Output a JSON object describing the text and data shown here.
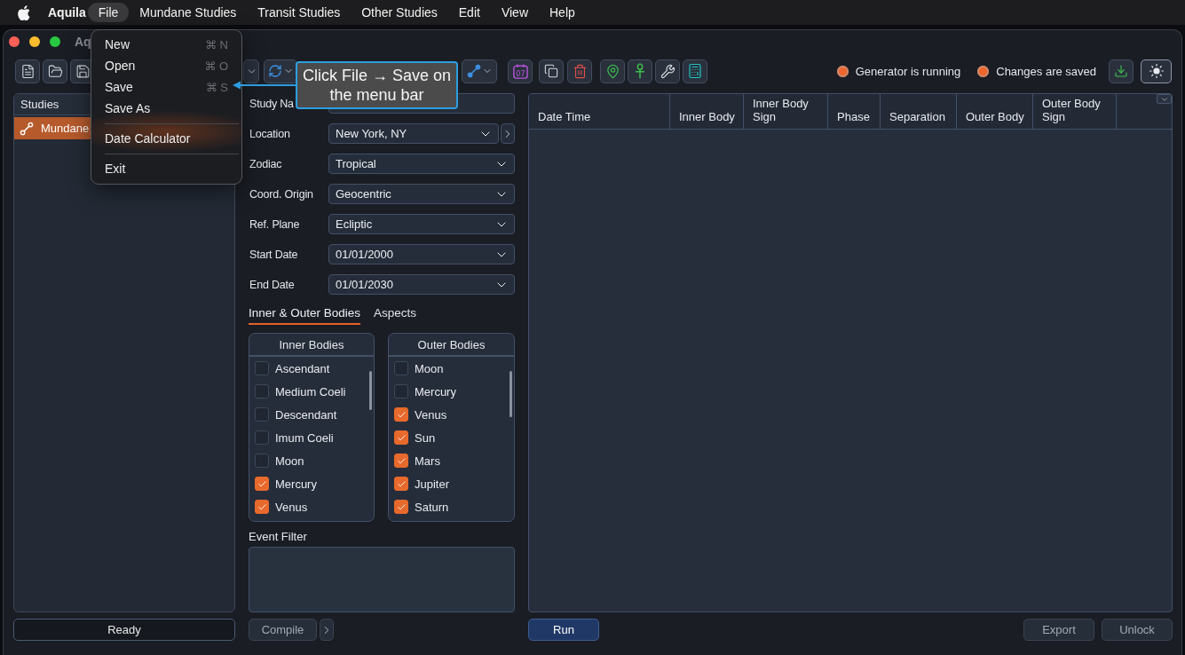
{
  "menu_bar": {
    "app_name": "Aquila",
    "items": [
      {
        "label": "File",
        "selected": true
      },
      {
        "label": "Mundane Studies",
        "selected": false
      },
      {
        "label": "Transit Studies",
        "selected": false
      },
      {
        "label": "Other Studies",
        "selected": false
      },
      {
        "label": "Edit",
        "selected": false
      },
      {
        "label": "View",
        "selected": false
      },
      {
        "label": "Help",
        "selected": false
      }
    ]
  },
  "file_menu": {
    "items": [
      {
        "kind": "item",
        "label": "New",
        "shortcut": "⌘ N"
      },
      {
        "kind": "item",
        "label": "Open",
        "shortcut": "⌘ O"
      },
      {
        "kind": "item",
        "label": "Save",
        "shortcut": "⌘ S"
      },
      {
        "kind": "item",
        "label": "Save As"
      },
      {
        "kind": "separator"
      },
      {
        "kind": "item",
        "label": "Date Calculator"
      },
      {
        "kind": "separator"
      },
      {
        "kind": "item",
        "label": "Exit"
      }
    ]
  },
  "window": {
    "title": "Aq"
  },
  "toolbar": {
    "calendar_day": "07",
    "status": [
      {
        "label": "Generator is running",
        "active": true
      },
      {
        "label": "Changes are saved",
        "active": true
      }
    ]
  },
  "callout": {
    "text": "Click File → Save on the menu bar"
  },
  "studies": {
    "title": "Studies",
    "items": [
      {
        "label": "Mundane",
        "selected": true
      }
    ],
    "status": "Ready"
  },
  "study_form": {
    "fields": [
      {
        "label": "Study Na",
        "kind": "text"
      },
      {
        "label": "Location",
        "kind": "select_link",
        "value": "New York, NY"
      },
      {
        "label": "Zodiac",
        "kind": "select",
        "value": "Tropical"
      },
      {
        "label": "Coord. Origin",
        "kind": "select",
        "value": "Geocentric"
      },
      {
        "label": "Ref. Plane",
        "kind": "select",
        "value": "Ecliptic"
      },
      {
        "label": "Start Date",
        "kind": "select",
        "value": "01/01/2000"
      },
      {
        "label": "End Date",
        "kind": "select",
        "value": "01/01/2030"
      }
    ]
  },
  "body_tabs": [
    {
      "label": "Inner & Outer Bodies",
      "selected": true
    },
    {
      "label": "Aspects",
      "selected": false
    }
  ],
  "inner_bodies": {
    "title": "Inner Bodies",
    "items": [
      {
        "label": "Ascendant",
        "checked": false
      },
      {
        "label": "Medium Coeli",
        "checked": false
      },
      {
        "label": "Descendant",
        "checked": false
      },
      {
        "label": "Imum Coeli",
        "checked": false
      },
      {
        "label": "Moon",
        "checked": false
      },
      {
        "label": "Mercury",
        "checked": true
      },
      {
        "label": "Venus",
        "checked": true
      }
    ]
  },
  "outer_bodies": {
    "title": "Outer Bodies",
    "items": [
      {
        "label": "Moon",
        "checked": false
      },
      {
        "label": "Mercury",
        "checked": false
      },
      {
        "label": "Venus",
        "checked": true
      },
      {
        "label": "Sun",
        "checked": true
      },
      {
        "label": "Mars",
        "checked": true
      },
      {
        "label": "Jupiter",
        "checked": true
      },
      {
        "label": "Saturn",
        "checked": true
      }
    ]
  },
  "event_filter": {
    "label": "Event Filter"
  },
  "compile_button": {
    "label": "Compile",
    "disabled": true
  },
  "results_table": {
    "columns": [
      "Date Time",
      "Inner Body",
      "Inner Body Sign",
      "Phase",
      "Separation",
      "Outer Body",
      "Outer Body Sign"
    ]
  },
  "run_button": {
    "label": "Run",
    "disabled": false
  },
  "actions": [
    {
      "label": "Export",
      "disabled": true
    },
    {
      "label": "Unlock",
      "disabled": true
    }
  ]
}
